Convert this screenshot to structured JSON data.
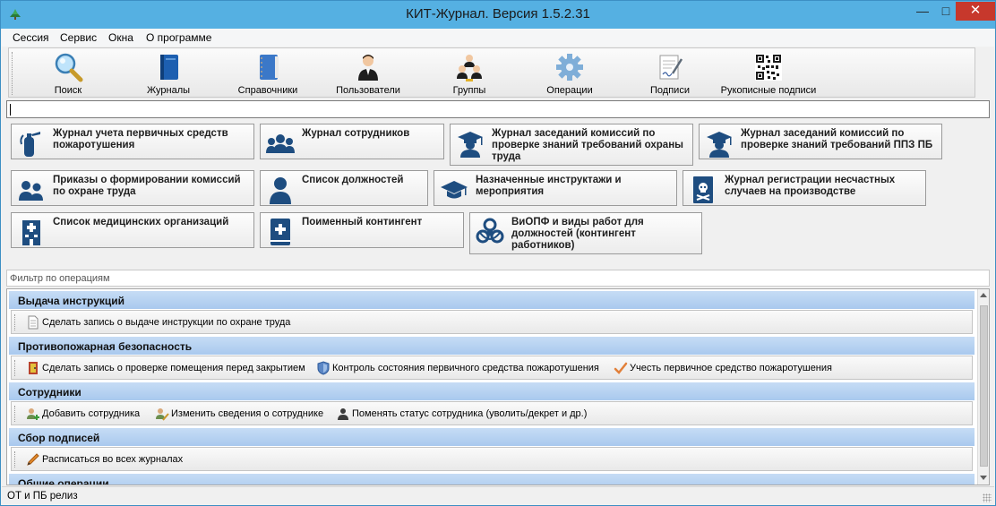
{
  "window": {
    "title": "КИТ-Журнал. Версия 1.5.2.31",
    "controls": {
      "minimize": "—",
      "maximize": "□",
      "close": "✕"
    }
  },
  "menu": [
    "Сессия",
    "Сервис",
    "Окна",
    "О программе"
  ],
  "toolbar": [
    {
      "label": "Поиск",
      "icon": "magnifier-icon"
    },
    {
      "label": "Журналы",
      "icon": "journal-book-icon"
    },
    {
      "label": "Справочники",
      "icon": "directory-book-icon"
    },
    {
      "label": "Пользователи",
      "icon": "user-icon"
    },
    {
      "label": "Группы",
      "icon": "users-group-icon"
    },
    {
      "label": "Операции",
      "icon": "gear-icon"
    },
    {
      "label": "Подписи",
      "icon": "signature-pen-icon"
    },
    {
      "label": "Рукописные подписи",
      "icon": "qr-code-icon"
    }
  ],
  "search": {
    "value": ""
  },
  "journals": [
    {
      "label": "Журнал учета первичных средств пожаротушения",
      "icon": "fire-extinguisher-icon"
    },
    {
      "label": "Журнал сотрудников",
      "icon": "employees-icon"
    },
    {
      "label": "Журнал заседаний комиссий по проверке знаний требований охраны труда",
      "icon": "graduate-icon"
    },
    {
      "label": "Журнал заседаний комиссий по проверке знаний требований ППЗ ПБ",
      "icon": "graduate-icon"
    },
    {
      "label": "Приказы о формировании комиссий по охране труда",
      "icon": "two-users-icon"
    },
    {
      "label": "Список должностей",
      "icon": "person-icon"
    },
    {
      "label": "Назначенные инструктажи и мероприятия",
      "icon": "mortarboard-icon"
    },
    {
      "label": "Журнал регистрации несчастных случаев на производстве",
      "icon": "skull-document-icon"
    },
    {
      "label": "Список медицинских организаций",
      "icon": "hospital-icon"
    },
    {
      "label": "Поименный контингент",
      "icon": "medical-book-icon"
    },
    {
      "label": "ВиОПФ и виды работ для должностей (контингент работников)",
      "icon": "biohazard-icon"
    }
  ],
  "filter": {
    "placeholder": "Фильтр по операциям"
  },
  "operations": [
    {
      "title": "Выдача инструкций",
      "items": [
        {
          "label": "Сделать запись о выдаче инструкции по охране труда",
          "icon": "document-icon"
        }
      ]
    },
    {
      "title": "Противопожарная безопасность",
      "items": [
        {
          "label": "Сделать запись о проверке помещения перед закрытием",
          "icon": "door-icon"
        },
        {
          "label": "Контроль состояния первичного средства пожаротушения",
          "icon": "shield-icon"
        },
        {
          "label": "Учесть первичное средство пожаротушения",
          "icon": "checkmark-icon"
        }
      ]
    },
    {
      "title": "Сотрудники",
      "items": [
        {
          "label": "Добавить сотрудника",
          "icon": "add-user-icon"
        },
        {
          "label": "Изменить сведения о сотруднике",
          "icon": "edit-user-icon"
        },
        {
          "label": "Поменять статус сотрудника (уволить/декрет и др.)",
          "icon": "user-status-icon"
        }
      ]
    },
    {
      "title": "Сбор подписей",
      "items": [
        {
          "label": "Расписаться во всех журналах",
          "icon": "pencil-icon"
        }
      ]
    },
    {
      "title": "Общие операции",
      "items": []
    }
  ],
  "status": {
    "text": "ОТ и ПБ релиз"
  },
  "colors": {
    "titlebar": "#55b0e2",
    "group_header": "#b6d1f1",
    "close_button": "#c7382c"
  }
}
